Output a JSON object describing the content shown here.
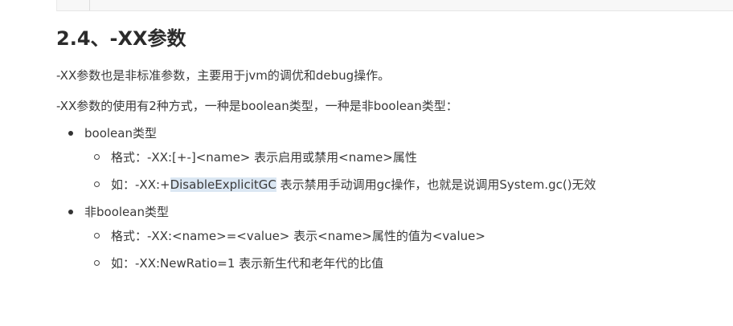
{
  "section": {
    "heading": "2.4、-XX参数",
    "paragraph1": "-XX参数也是非标准参数，主要用于jvm的调优和debug操作。",
    "paragraph2": "-XX参数的使用有2种方式，一种是boolean类型，一种是非boolean类型："
  },
  "list": {
    "boolean": {
      "label": "boolean类型",
      "format": "格式：-XX:[+-]<name> 表示启用或禁用<name>属性",
      "example_prefix": "如：-XX:+",
      "example_highlight": "DisableExplicitGC",
      "example_suffix": " 表示禁用手动调用gc操作，也就是说调用System.gc()无效"
    },
    "non_boolean": {
      "label": "非boolean类型",
      "format": "格式：-XX:<name>=<value>  表示<name>属性的值为<value>",
      "example": "如：-XX:NewRatio=1 表示新生代和老年代的比值"
    }
  },
  "colors": {
    "highlight": "#dbe7f3",
    "text": "#3a3a3a",
    "heading": "#2b2b2b"
  }
}
